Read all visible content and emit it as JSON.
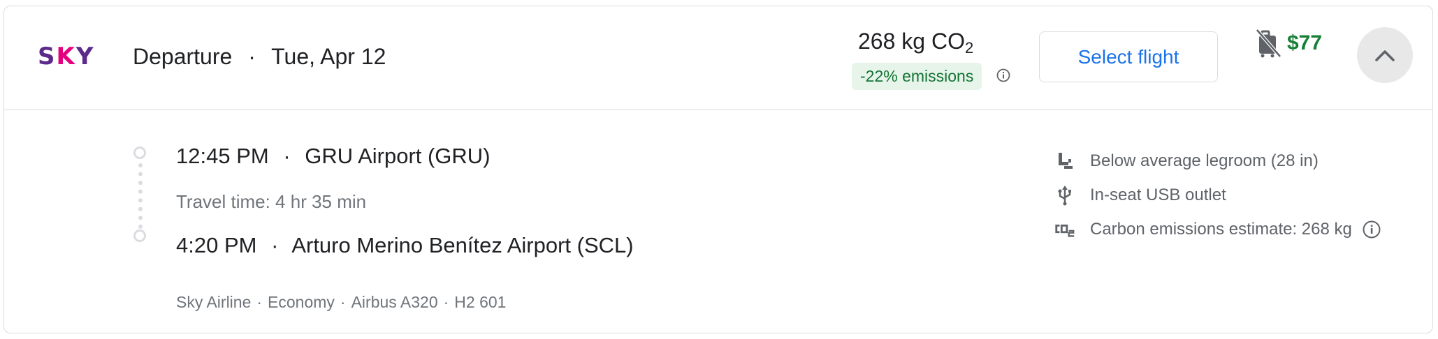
{
  "header": {
    "airline_logo_text": "SKY",
    "direction": "Departure",
    "date": "Tue, Apr 12",
    "separator": "·",
    "co2_amount": "268 kg CO",
    "co2_subscript": "2",
    "emissions_badge": "-22% emissions",
    "select_button_label": "Select flight",
    "price": "$77",
    "bag_icon": "no-carry-on-bag-icon",
    "collapse_icon": "chevron-up-icon"
  },
  "itinerary": {
    "departure_time": "12:45 PM",
    "departure_airport": "GRU Airport (GRU)",
    "travel_time": "Travel time: 4 hr 35 min",
    "arrival_time": "4:20 PM",
    "arrival_airport": "Arturo Merino Benítez Airport (SCL)",
    "details": [
      "Sky Airline",
      "Economy",
      "Airbus A320",
      "H2 601"
    ]
  },
  "amenities": [
    {
      "icon": "legroom-seat-icon",
      "label": "Below average legroom (28 in)"
    },
    {
      "icon": "usb-icon",
      "label": "In-seat USB outlet"
    },
    {
      "icon": "co2-icon",
      "label": "Carbon emissions estimate: 268 kg"
    }
  ],
  "colors": {
    "accent_blue": "#1a73e8",
    "price_green": "#188038",
    "badge_bg": "#e6f4ea",
    "badge_text": "#137333",
    "logo_purple": "#5b2a8a",
    "logo_pink": "#e5007d"
  }
}
